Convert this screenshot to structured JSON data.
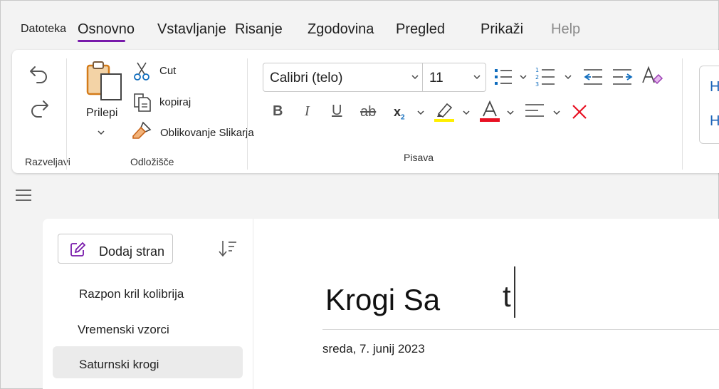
{
  "menu": {
    "tabs": [
      {
        "label": "Datoteka"
      },
      {
        "label": "Osnovno",
        "active": true
      },
      {
        "label": "Vstavljanje"
      },
      {
        "label": "Risanje"
      },
      {
        "label": "Zgodovina"
      },
      {
        "label": "Pregled"
      },
      {
        "label": "Prikaži"
      },
      {
        "label": "Help",
        "disabled": true
      }
    ]
  },
  "ribbon": {
    "undo": {
      "group_label": "Razveljavi"
    },
    "clipboard": {
      "paste_label": "Prilepi",
      "cut_label": "Cut",
      "copy_label": "kopiraj",
      "format_painter_label": "Oblikovanje Slikarja",
      "group_label": "Odložišče"
    },
    "font": {
      "font_name": "Calibri (telo)",
      "font_size": "11",
      "group_label": "Pisava"
    }
  },
  "sidebar": {
    "add_page_label": "Dodaj stran",
    "pages": [
      {
        "title": "Razpon kril kolibrija"
      },
      {
        "title": "Vremenski vzorci"
      },
      {
        "title": "Saturnski krogi",
        "selected": true
      }
    ]
  },
  "page": {
    "title": "Krogi Sa",
    "title_trailing": "t",
    "date": "sreda, 7. junij 2023"
  },
  "colors": {
    "accent": "#7719aa",
    "highlight": "#ffef00",
    "font_color": "#e81123",
    "list_blue": "#0f6cbd"
  },
  "icons": [
    "undo-icon",
    "redo-icon",
    "paste-icon",
    "cut-icon",
    "copy-icon",
    "format-painter-icon",
    "bullets-icon",
    "numbering-icon",
    "decrease-indent-icon",
    "increase-indent-icon",
    "clear-formatting-icon",
    "bold-icon",
    "italic-icon",
    "underline-icon",
    "strikethrough-icon",
    "subscript-icon",
    "highlight-icon",
    "font-color-icon",
    "align-icon",
    "delete-icon",
    "hamburger-icon",
    "new-page-icon",
    "sort-icon"
  ]
}
